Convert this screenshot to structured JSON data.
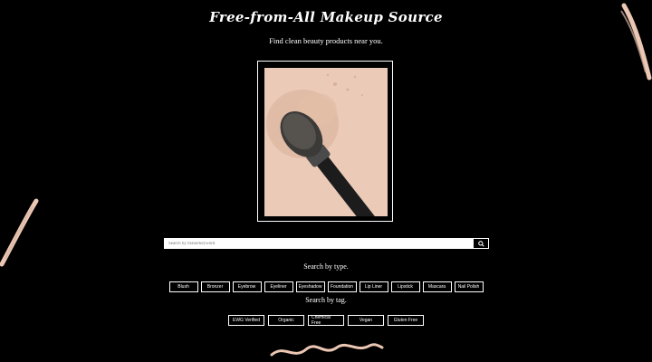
{
  "header": {
    "title": "Free-from-All Makeup Source",
    "subtitle": "Find clean beauty products near you."
  },
  "hero": {
    "image_icon": "makeup-brush-with-powder"
  },
  "search": {
    "placeholder": "Search by brand/keyword",
    "button_icon": "search-icon"
  },
  "types": {
    "label": "Search by type.",
    "items": [
      "Blush",
      "Bronzer",
      "Eyebrow",
      "Eyeliner",
      "Eyeshadow",
      "Foundation",
      "Lip Liner",
      "Lipstick",
      "Mascara",
      "Nail Polish"
    ]
  },
  "tags": {
    "label": "Search by tag.",
    "items": [
      "EWG Verified",
      "Organic",
      "Chemical Free",
      "Vegan",
      "Gluten Free"
    ]
  },
  "colors": {
    "background": "#000000",
    "accent": "#ebcab8",
    "text": "#ffffff"
  }
}
